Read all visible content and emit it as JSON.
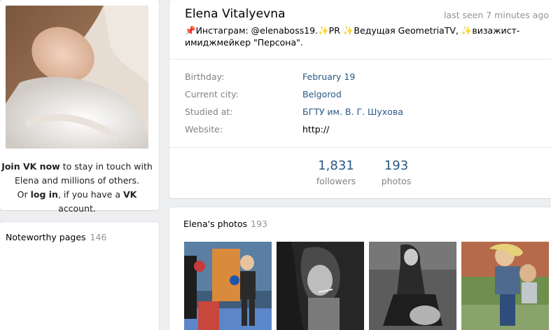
{
  "left": {
    "join": {
      "join_link": "Join VK now",
      "join_rest": " to stay in touch with",
      "line2": "Elena and millions of others.",
      "or": "Or ",
      "login_link": "log in",
      "if_have": ", if you have a ",
      "vk": "VK",
      "account": " account."
    },
    "noteworthy": {
      "label": "Noteworthy pages",
      "count": "146"
    }
  },
  "profile": {
    "name": "Elena Vitalyevna",
    "last_seen": "last seen 7 minutes ago",
    "status": "📌Инстаграм: @elenaboss19.✨PR ✨Ведущая GeometriaTV, ✨визажист-имиджмейкер \"Персона\".",
    "info": [
      {
        "label": "Birthday:",
        "value": "February 19"
      },
      {
        "label": "Current city:",
        "value": "Belgorod"
      },
      {
        "label": "Studied at:",
        "value": "БГТУ им. В. Г. Шухова"
      },
      {
        "label": "Website:",
        "value": "http://"
      }
    ],
    "counters": [
      {
        "num": "1,831",
        "label": "followers"
      },
      {
        "num": "193",
        "label": "photos"
      }
    ]
  },
  "photos": {
    "label": "Elena's photos",
    "count": "193"
  },
  "colors": {
    "link": "#2a5885",
    "muted": "#828282",
    "background": "#edeef0"
  }
}
